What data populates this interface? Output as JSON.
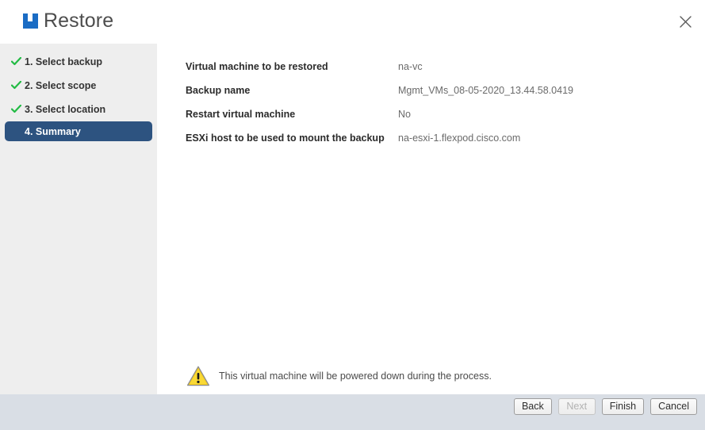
{
  "header": {
    "title": "Restore",
    "logo_icon": "netapp-logo-icon",
    "logo_color": "#1a6cc4",
    "close_icon": "close-icon"
  },
  "sidebar": {
    "background_color": "#eeeeee",
    "selected_color": "#2d5380",
    "check_color": "#22bb44",
    "steps": [
      {
        "label": "1. Select backup",
        "state": "complete",
        "icon": "check-icon"
      },
      {
        "label": "2. Select scope",
        "state": "complete",
        "icon": "check-icon"
      },
      {
        "label": "3. Select location",
        "state": "complete",
        "icon": "check-icon"
      },
      {
        "label": "4. Summary",
        "state": "current",
        "icon": ""
      }
    ]
  },
  "summary": {
    "rows": [
      {
        "label": "Virtual machine to be restored",
        "value": "na-vc"
      },
      {
        "label": "Backup name",
        "value": "Mgmt_VMs_08-05-2020_13.44.58.0419"
      },
      {
        "label": "Restart virtual machine",
        "value": "No"
      },
      {
        "label": "ESXi host to be used to mount the backup",
        "value": "na-esxi-1.flexpod.cisco.com"
      }
    ]
  },
  "warning": {
    "icon": "warning-triangle-icon",
    "icon_color": "#f5c518",
    "text": "This virtual machine will be powered down during the process."
  },
  "footer": {
    "background_color": "#d9dee5",
    "buttons": [
      {
        "label": "Back",
        "enabled": true
      },
      {
        "label": "Next",
        "enabled": false
      },
      {
        "label": "Finish",
        "enabled": true
      },
      {
        "label": "Cancel",
        "enabled": true
      }
    ]
  }
}
